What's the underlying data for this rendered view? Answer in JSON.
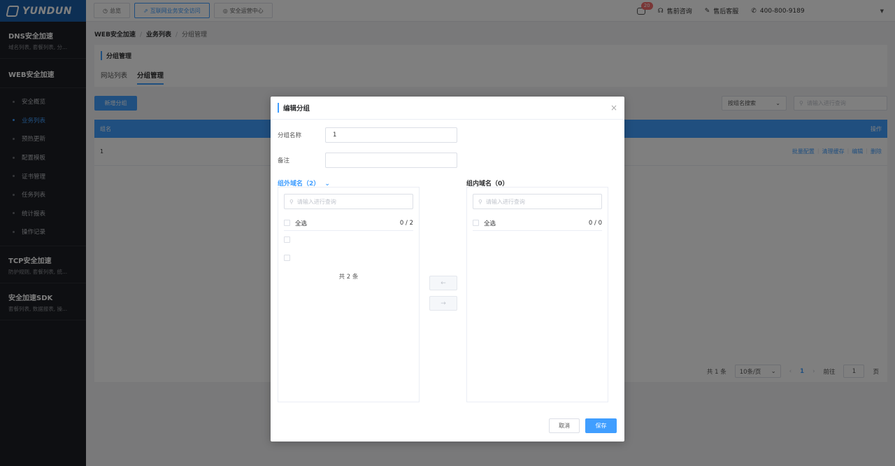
{
  "brand": {
    "name": "YUNDUN"
  },
  "sidebar": {
    "groups_top": [
      {
        "title": "DNS安全加速",
        "sub": "域名列表, 套餐列表, 分..."
      }
    ],
    "web_title": "WEB安全加速",
    "items": [
      {
        "label": "安全概览"
      },
      {
        "label": "业务列表"
      },
      {
        "label": "预热更新"
      },
      {
        "label": "配置模板"
      },
      {
        "label": "证书管理"
      },
      {
        "label": "任务列表"
      },
      {
        "label": "统计报表"
      },
      {
        "label": "操作记录"
      }
    ],
    "groups_bottom": [
      {
        "title": "TCP安全加速",
        "sub": "防护规则, 套餐列表, 统..."
      },
      {
        "title": "安全加速SDK",
        "sub": "套餐列表, 数据报表, 操..."
      }
    ]
  },
  "topbar": {
    "nav": [
      {
        "label": "总览"
      },
      {
        "label": "互联网业务安全访问"
      },
      {
        "label": "安全运营中心"
      }
    ],
    "notification_count": "20",
    "presale": "售前咨询",
    "aftersale": "售后客服",
    "phone": "400-800-9189"
  },
  "breadcrumb": {
    "b1": "WEB安全加速",
    "b2": "业务列表",
    "b3": "分组管理"
  },
  "card": {
    "title": "分组管理",
    "tabs": [
      "网站列表",
      "分组管理"
    ]
  },
  "toolbar": {
    "new_group": "新增分组",
    "search_type": "按组名搜索",
    "search_placeholder": "请输入进行查询"
  },
  "table": {
    "col_name": "组名",
    "col_ops": "操作",
    "rows": [
      {
        "name": "1",
        "ops": [
          "批量配置",
          "清理缓存",
          "编辑",
          "删除"
        ]
      }
    ]
  },
  "pager": {
    "total": "共 1 条",
    "page_size": "10条/页",
    "current": "1",
    "goto_label": "前往",
    "goto_value": "1",
    "page_unit": "页"
  },
  "dialog": {
    "title": "编辑分组",
    "name_label": "分组名称",
    "name_value": "1",
    "note_label": "备注",
    "note_value": "",
    "left_title": "组外域名（2）",
    "right_title": "组内域名（0）",
    "search_placeholder": "请输入进行查询",
    "select_all": "全选",
    "left_count": "0 / 2",
    "right_count": "0 / 0",
    "left_total": "共 2 条",
    "cancel": "取消",
    "save": "保存"
  }
}
